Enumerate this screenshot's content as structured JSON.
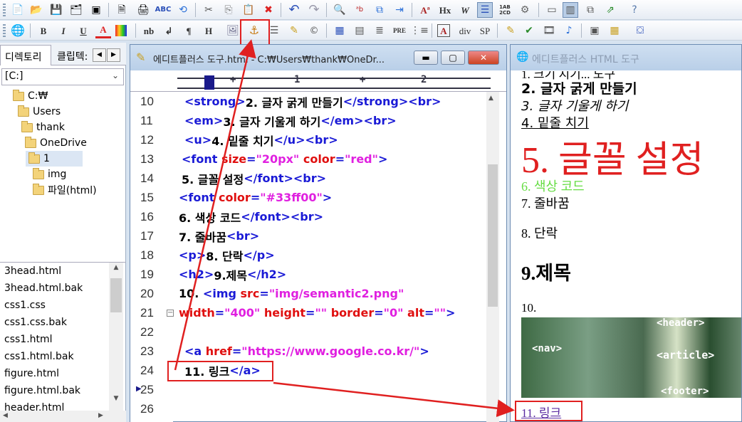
{
  "toolbar1": {
    "font_buttons": [
      "Hx",
      "W"
    ],
    "abc_badge": "1AB\n2CD"
  },
  "toolbar2": {
    "buttons": [
      "B",
      "I",
      "U",
      "A",
      "nb",
      "↲",
      "¶",
      "H",
      "PRE",
      "A",
      "div",
      "SP"
    ]
  },
  "left_pane": {
    "tabs": [
      "디렉토리",
      "클립텍:"
    ],
    "drive": "[C:]",
    "tree": [
      "C:₩",
      "Users",
      "thank",
      "OneDrive",
      "1",
      "img",
      "파일(html)"
    ],
    "files": [
      "3head.html",
      "3head.html.bak",
      "css1.css",
      "css1.css.bak",
      "css1.html",
      "css1.html.bak",
      "figure.html",
      "figure.html.bak",
      "header.html"
    ]
  },
  "editor": {
    "title": "에디트플러스 도구.html - C:₩Users₩thank₩OneDr...",
    "ruler_marks": [
      "1",
      "2"
    ],
    "line_numbers": [
      "10",
      "11",
      "12",
      "13",
      "14",
      "15",
      "16",
      "17",
      "18",
      "19",
      "20",
      "21",
      "22",
      "23",
      "24",
      "25",
      "26"
    ],
    "lines": [
      [
        [
          "t",
          "<strong>"
        ],
        [
          "x",
          "2. 글자 굵게 만들기"
        ],
        [
          "t",
          "</strong><br>"
        ]
      ],
      [
        [
          "t",
          "<em>"
        ],
        [
          "x",
          "3. 글자 기울게 하기"
        ],
        [
          "t",
          "</em><br>"
        ]
      ],
      [
        [
          "t",
          "<u>"
        ],
        [
          "x",
          "4. 밑줄 치기"
        ],
        [
          "t",
          "</u><br>"
        ]
      ],
      [
        [
          "t",
          "<font "
        ],
        [
          "a",
          "size"
        ],
        [
          "t",
          "="
        ],
        [
          "v",
          "\"20px\""
        ],
        [
          "t",
          " "
        ],
        [
          "a",
          "color"
        ],
        [
          "t",
          "="
        ],
        [
          "v",
          "\"red\""
        ],
        [
          "t",
          ">"
        ]
      ],
      [
        [
          "x",
          "5. 글꼴 설정"
        ],
        [
          "t",
          "</font><br>"
        ]
      ],
      [
        [
          "t",
          "<font "
        ],
        [
          "a",
          "color"
        ],
        [
          "t",
          "="
        ],
        [
          "v",
          "\"#33ff00\""
        ],
        [
          "t",
          ">"
        ]
      ],
      [
        [
          "x",
          "6. 색상 코드"
        ],
        [
          "t",
          "</font><br>"
        ]
      ],
      [
        [
          "x",
          "7. 줄바꿈"
        ],
        [
          "t",
          "<br>"
        ]
      ],
      [
        [
          "t",
          "<p>"
        ],
        [
          "x",
          "8. 단락"
        ],
        [
          "t",
          "</p>"
        ]
      ],
      [
        [
          "t",
          "<h2>"
        ],
        [
          "x",
          "9.제목"
        ],
        [
          "t",
          "</h2>"
        ]
      ],
      [
        [
          "x",
          "10. "
        ],
        [
          "t",
          "<img "
        ],
        [
          "a",
          "src"
        ],
        [
          "t",
          "="
        ],
        [
          "v",
          "\"img/semantic2.png\""
        ]
      ],
      [
        [
          "a",
          "width"
        ],
        [
          "t",
          "="
        ],
        [
          "v",
          "\"400\""
        ],
        [
          "t",
          " "
        ],
        [
          "a",
          "height"
        ],
        [
          "t",
          "="
        ],
        [
          "v",
          "\"\""
        ],
        [
          "t",
          " "
        ],
        [
          "a",
          "border"
        ],
        [
          "t",
          "="
        ],
        [
          "v",
          "\"0\""
        ],
        [
          "t",
          " "
        ],
        [
          "a",
          "alt"
        ],
        [
          "t",
          "="
        ],
        [
          "v",
          "\"\""
        ],
        [
          "t",
          ">"
        ]
      ],
      [],
      [
        [
          "t",
          "<a "
        ],
        [
          "a",
          "href"
        ],
        [
          "t",
          "="
        ],
        [
          "v",
          "\"https://www.google.co.kr/\""
        ],
        [
          "t",
          ">"
        ]
      ],
      [
        [
          "x",
          "11. 링크"
        ],
        [
          "t",
          "</a>"
        ]
      ],
      [],
      []
    ],
    "indents": [
      16,
      16,
      16,
      12,
      12,
      8,
      8,
      8,
      8,
      8,
      8,
      8,
      8,
      16,
      16,
      8,
      8
    ]
  },
  "preview": {
    "title": "에디트플러스 HTML 도구",
    "line1_partial": "1. 크기 지기... 도구",
    "bold": "2. 글자 굵게 만들기",
    "italic": "3. 글자 기울게 하기",
    "underline": "4. 밑줄 치기",
    "big_red": "5. 글꼴 설정",
    "green": "6. 색상 코드",
    "br": "7. 줄바꿈",
    "para": "8. 단락",
    "h2": "9.제목",
    "num10": "10.",
    "img_labels": [
      "<header>",
      "<nav>",
      "<article>",
      "<footer>"
    ],
    "link": "11. 링크",
    "colors": {
      "red": "#e02020",
      "green": "#66dd44",
      "link": "#5a2aa0"
    }
  }
}
